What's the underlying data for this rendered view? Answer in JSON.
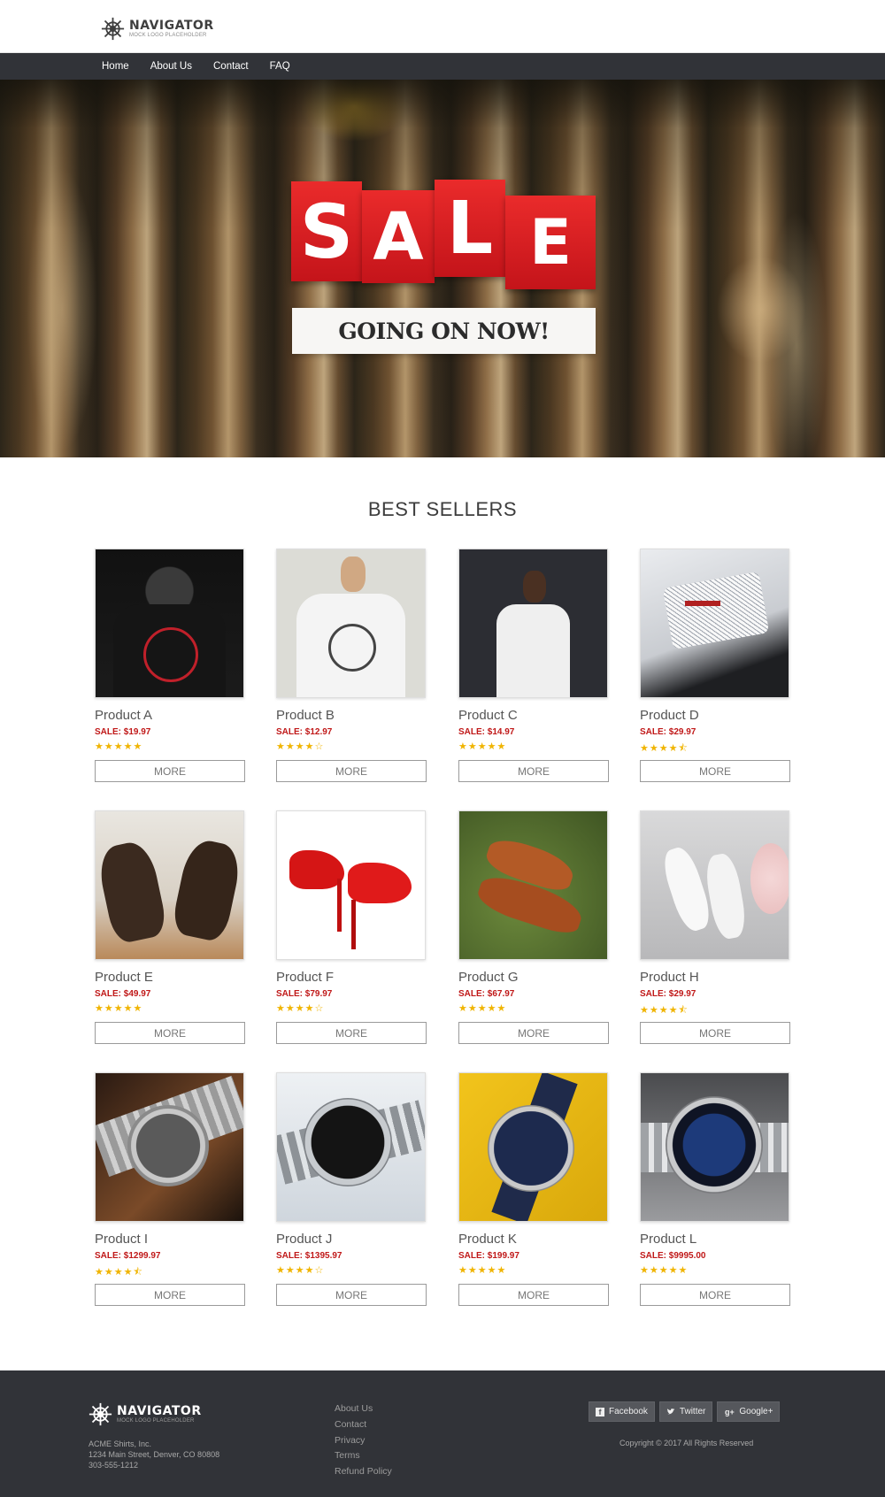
{
  "brand": {
    "name": "NAVIGATOR",
    "tagline": "MOCK LOGO PLACEHOLDER",
    "logo_icon": "ship-wheel-icon"
  },
  "nav": {
    "items": [
      {
        "label": "Home"
      },
      {
        "label": "About Us"
      },
      {
        "label": "Contact"
      },
      {
        "label": "FAQ"
      }
    ]
  },
  "hero": {
    "sale_letters": [
      "S",
      "A",
      "L",
      "E"
    ],
    "subtitle": "GOING ON NOW!",
    "accent_color": "#d71d22"
  },
  "best_sellers": {
    "title": "BEST SELLERS",
    "button_label": "MORE",
    "products": [
      {
        "name": "Product A",
        "price": "SALE: $19.97",
        "rating": 5,
        "stars": "★★★★★",
        "image": "black-tshirt"
      },
      {
        "name": "Product B",
        "price": "SALE: $12.97",
        "rating": 4,
        "stars": "★★★★☆",
        "image": "white-tshirt"
      },
      {
        "name": "Product C",
        "price": "SALE: $14.97",
        "rating": 5,
        "stars": "★★★★★",
        "image": "white-tshirt-dark"
      },
      {
        "name": "Product D",
        "price": "SALE: $29.97",
        "rating": 4.5,
        "stars": "★★★★⯪",
        "image": "dress-shirt"
      },
      {
        "name": "Product E",
        "price": "SALE: $49.97",
        "rating": 5,
        "stars": "★★★★★",
        "image": "brown-dress-shoes"
      },
      {
        "name": "Product F",
        "price": "SALE: $79.97",
        "rating": 4,
        "stars": "★★★★☆",
        "image": "red-heels"
      },
      {
        "name": "Product G",
        "price": "SALE: $67.97",
        "rating": 5,
        "stars": "★★★★★",
        "image": "tan-oxfords"
      },
      {
        "name": "Product H",
        "price": "SALE: $29.97",
        "rating": 4.5,
        "stars": "★★★★⯪",
        "image": "white-heels"
      },
      {
        "name": "Product I",
        "price": "SALE: $1299.97",
        "rating": 4.5,
        "stars": "★★★★⯪",
        "image": "chronograph-watch"
      },
      {
        "name": "Product J",
        "price": "SALE: $1395.97",
        "rating": 4,
        "stars": "★★★★☆",
        "image": "black-dial-watch"
      },
      {
        "name": "Product K",
        "price": "SALE: $199.97",
        "rating": 5,
        "stars": "★★★★★",
        "image": "navy-watch"
      },
      {
        "name": "Product L",
        "price": "SALE: $9995.00",
        "rating": 5,
        "stars": "★★★★★",
        "image": "diver-watch"
      }
    ]
  },
  "footer": {
    "company": "ACME Shirts, Inc.",
    "address": "1234 Main Street, Denver, CO 80808",
    "phone": "303-555-1212",
    "links": [
      {
        "label": "About Us"
      },
      {
        "label": "Contact"
      },
      {
        "label": "Privacy"
      },
      {
        "label": "Terms"
      },
      {
        "label": "Refund Policy"
      }
    ],
    "social": [
      {
        "label": "Facebook",
        "icon": "facebook-icon"
      },
      {
        "label": "Twitter",
        "icon": "twitter-icon"
      },
      {
        "label": "Google+",
        "icon": "google-plus-icon"
      }
    ],
    "copyright": "Copyright © 2017 All Rights Reserved"
  },
  "colors": {
    "nav_bg": "#313338",
    "price_red": "#c01818",
    "star_gold": "#f0b400"
  }
}
